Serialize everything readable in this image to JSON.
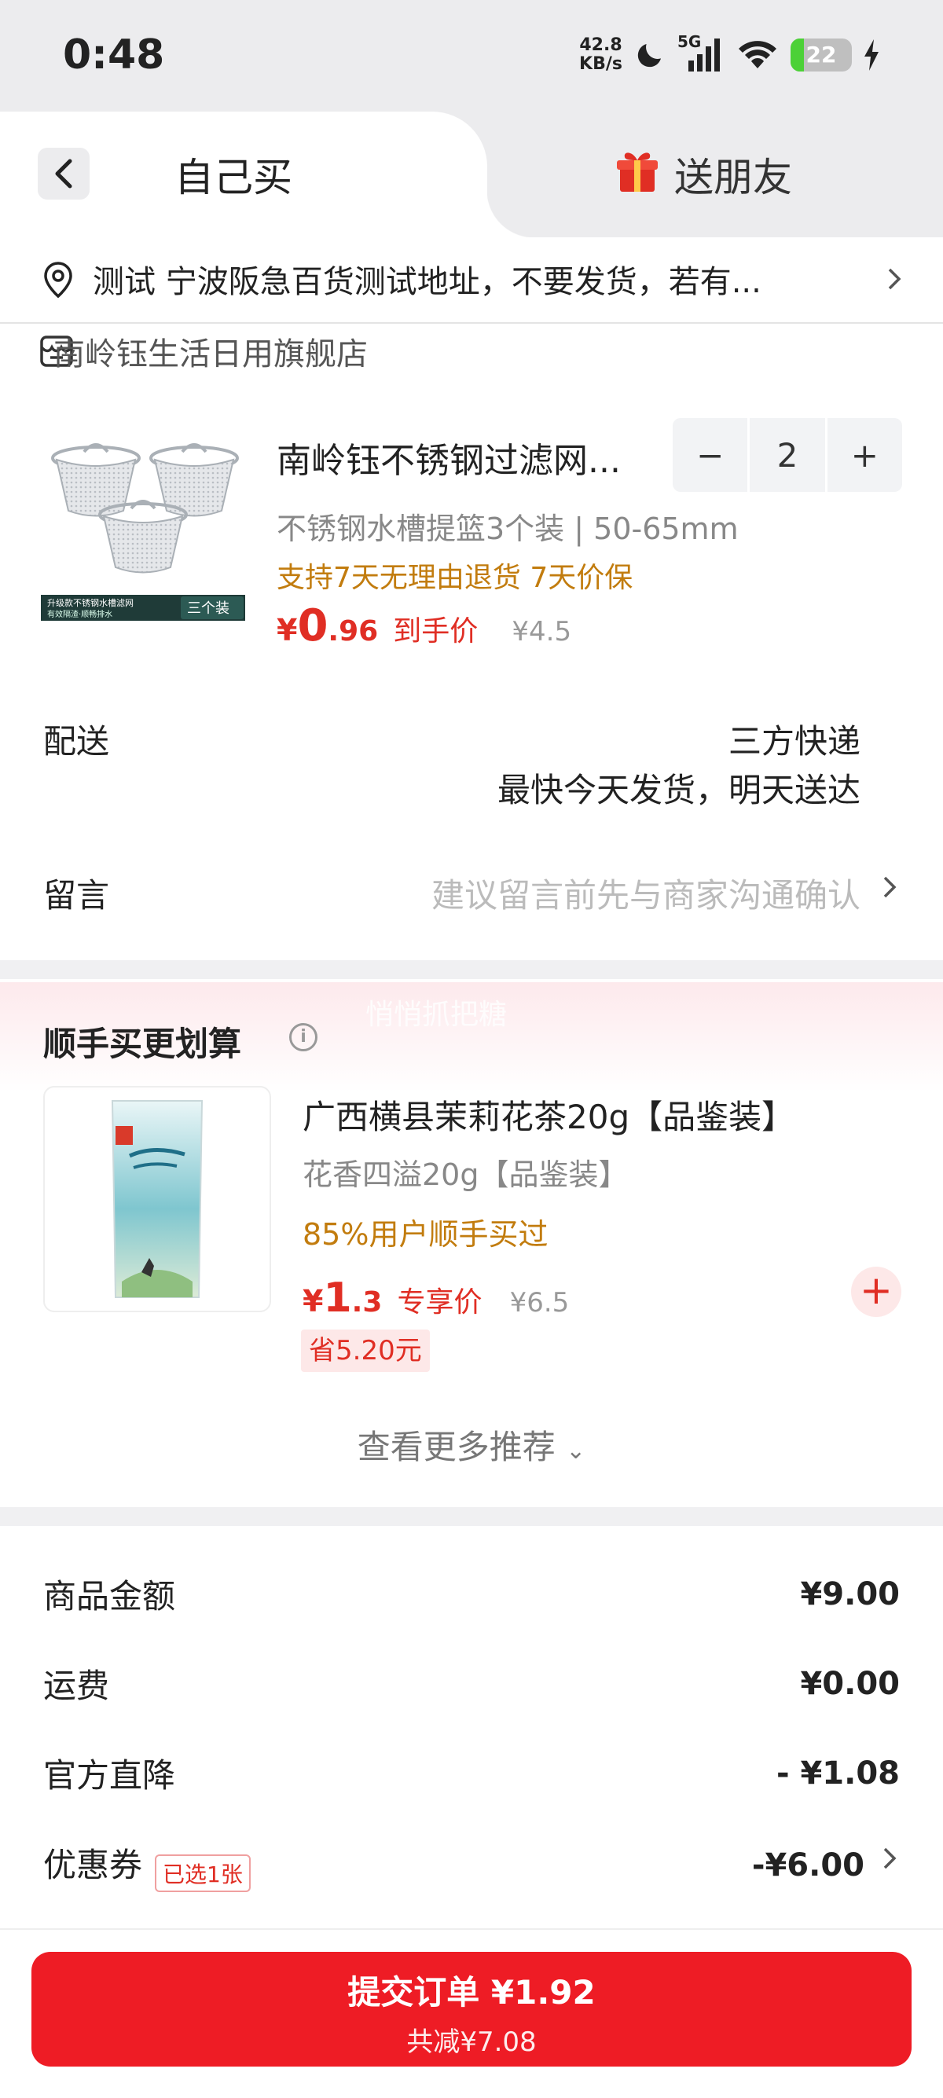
{
  "status_bar": {
    "time": "0:48",
    "speed_value": "42.8",
    "speed_unit": "KB/s",
    "network": "5G",
    "battery": "22",
    "battery_level": 0.22
  },
  "tabs": {
    "self": "自己买",
    "friend": "送朋友"
  },
  "address": {
    "text": "测试  宁波阪急百货测试地址，不要发货，若有..."
  },
  "store": {
    "name": "南岭钰生活日用旗舰店"
  },
  "product": {
    "title": "南岭钰不锈钢过滤网...",
    "spec": "不锈钢水槽提篮3个装 | 50-65mm",
    "promo": "支持7天无理由退货  7天价保",
    "currency": "¥",
    "price_int": "0",
    "price_dec": ".96",
    "price_tag": "到手价",
    "orig_price": "¥4.5",
    "quantity": "2",
    "minus": "−",
    "plus": "+",
    "image_banner": "升级款不锈钢水槽滤网",
    "image_banner2": "有效隔渣·顺畅排水",
    "image_badge": "三个装"
  },
  "delivery": {
    "label": "配送",
    "method": "三方快递",
    "eta": "最快今天发货，明天送达"
  },
  "message": {
    "label": "留言",
    "placeholder": "建议留言前先与商家沟通确认"
  },
  "recommend": {
    "watermark": "悄悄抓把糖",
    "title": "顺手买更划算",
    "info": "i",
    "item_title": "广西横县茉莉花茶20g【品鉴装】",
    "item_spec": "花香四溢20g【品鉴装】",
    "item_promo": "85%用户顺手买过",
    "currency": "¥",
    "price_int": "1",
    "price_dec": ".3",
    "price_tag": "专享价",
    "orig_price": "¥6.5",
    "save": "省5.20元",
    "add": "+",
    "more": "查看更多推荐"
  },
  "summary": {
    "goods_label": "商品金额",
    "goods_value": "¥9.00",
    "shipping_label": "运费",
    "shipping_value": "¥0.00",
    "discount_label": "官方直降",
    "discount_value": "- ¥1.08",
    "coupon_label": "优惠券",
    "coupon_tag": "已选1张",
    "coupon_value": "-¥6.00"
  },
  "submit": {
    "label": "提交订单 ¥1.92",
    "sub": "共减¥7.08"
  },
  "colors": {
    "accent": "#ee1c25",
    "price": "#e02e24",
    "promo": "#c27c0e"
  }
}
